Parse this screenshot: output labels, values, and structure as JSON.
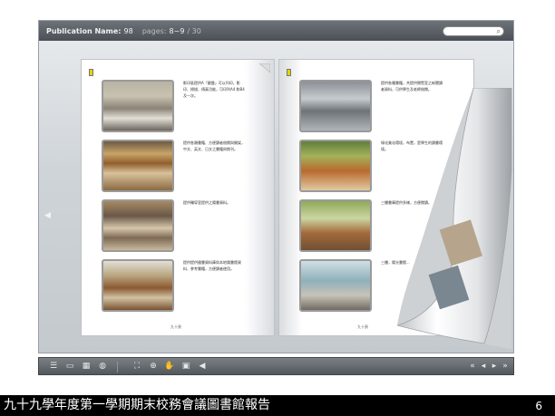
{
  "topbar": {
    "publication_label": "Publication Name:",
    "publication_value": "98",
    "pages_label": "pages:",
    "pages_value": "8~9",
    "pages_total": "/ 30"
  },
  "left_page": {
    "notes": [
      "影印區提供A「鍵盤」可以列印，影印、掃描、傳真功能，可印列A4 和B4 及一次。",
      "提供各類書籍、方便讀者借閱與開架，中文、英文、日文之書籍與期刊。",
      "提供輔導室提供之陽書資料。",
      "提供提供國書資料庫與本地陽書館資料、參考書籍，方便讀者使用。"
    ],
    "page_number": "九十頁"
  },
  "right_page": {
    "notes": [
      "提供各種書籍，共提供閱覽室之新聞讀者資料，可供學生及老師借閱。",
      "綠化美化環境，布置，是學生的讀書環境。",
      "三樓書庫提供多樣，方便閱讀。",
      "三樓，陽光書館..."
    ],
    "page_number": "九十頁"
  },
  "toolbar": {
    "icons": [
      "toc-icon",
      "page-icon",
      "thumbnails-icon",
      "share-icon",
      "fit-icon",
      "zoom-in-icon",
      "hand-icon",
      "save-icon",
      "sound-icon"
    ],
    "nav_icons": [
      "first-icon",
      "prev-icon",
      "next-icon",
      "last-icon"
    ]
  },
  "caption": {
    "title": "九十九學年度第一學期期末校務會議圖書館報告",
    "slide_number": "6"
  }
}
